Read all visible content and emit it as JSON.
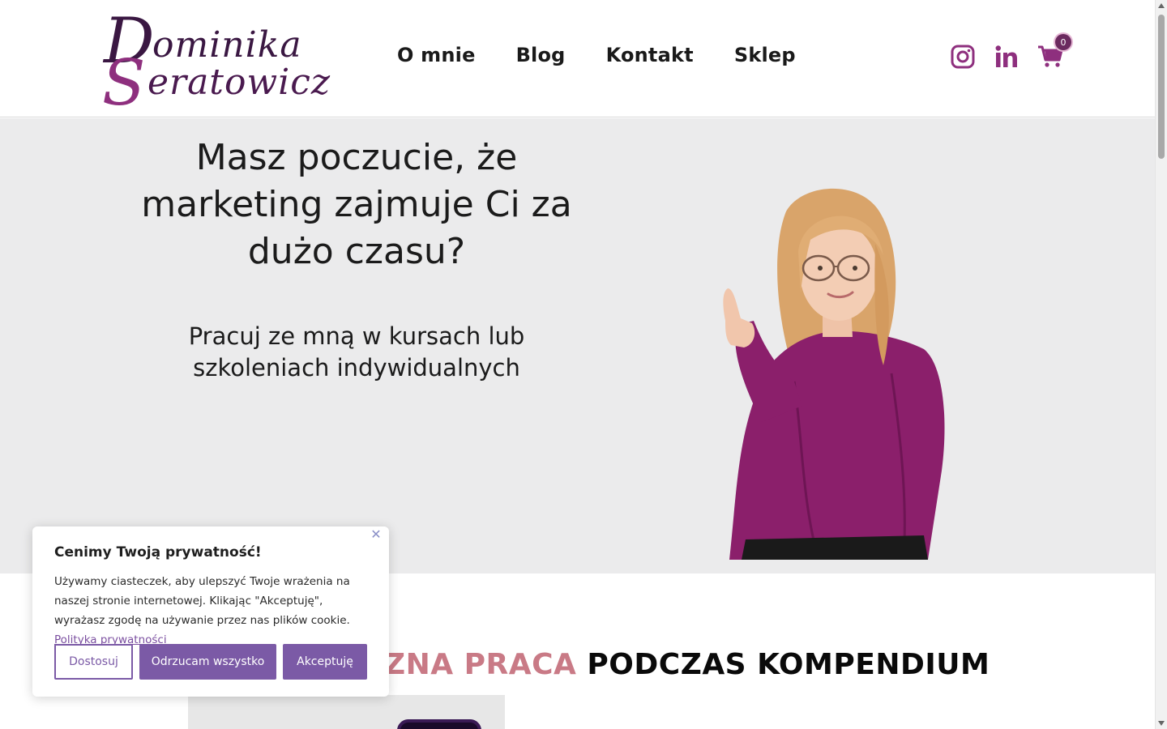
{
  "header": {
    "logo_line1_cap": "D",
    "logo_line1_rest": "ominika",
    "logo_line2_cap": "S",
    "logo_line2_rest": "eratowicz",
    "nav": [
      "O mnie",
      "Blog",
      "Kontakt",
      "Sklep"
    ],
    "cart_count": "0",
    "icons": [
      "instagram-icon",
      "linkedin-icon",
      "cart-icon"
    ],
    "brand_color": "#8e2f7e"
  },
  "hero": {
    "title": "Masz poczucie, że marketing zajmuje Ci za dużo czasu?",
    "subtitle": "Pracuj ze mną w kursach lub szkoleniach indywidualnych"
  },
  "section": {
    "heading_pink": "ZNA PRACA",
    "heading_dark": "PODCZAS KOMPENDIUM"
  },
  "cookie": {
    "title": "Cenimy Twoją prywatność!",
    "text": "Używamy ciasteczek, aby ulepszyć Twoje wrażenia na naszej stronie internetowej. Klikając \"Akceptuję\", wyrażasz zgodę na używanie przez nas plików cookie.",
    "policy_link": "Polityka prywatności",
    "customize_label": "Dostosuj",
    "reject_label": "Odrzucam wszystko",
    "accept_label": "Akceptuję",
    "accent_color": "#7b5aa6"
  }
}
